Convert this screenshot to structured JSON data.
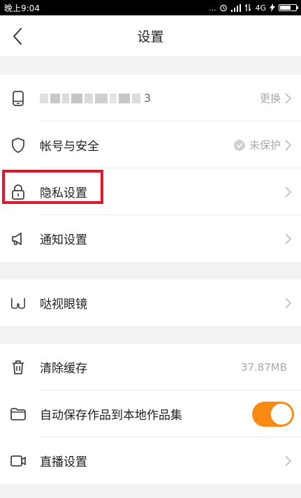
{
  "status_bar": {
    "time": "晚上9:04",
    "dots": "...",
    "network": "4G",
    "battery_level": 0.7
  },
  "header": {
    "title": "设置",
    "back_icon": "chevron-left-icon"
  },
  "account": {
    "masked_tail": "3",
    "change_label": "更换"
  },
  "security": {
    "label": "帐号与安全",
    "status": "未保护"
  },
  "privacy": {
    "label": "隐私设置"
  },
  "notify": {
    "label": "通知设置"
  },
  "glasses": {
    "label": "哒视眼镜"
  },
  "cache": {
    "label": "清除缓存",
    "size": "37.87MB"
  },
  "autosave": {
    "label": "自动保存作品到本地作品集",
    "enabled": true
  },
  "live": {
    "label": "直播设置"
  },
  "colors": {
    "accent": "#fb8a14",
    "highlight": "#e0162b",
    "muted": "#aaaaaa"
  }
}
